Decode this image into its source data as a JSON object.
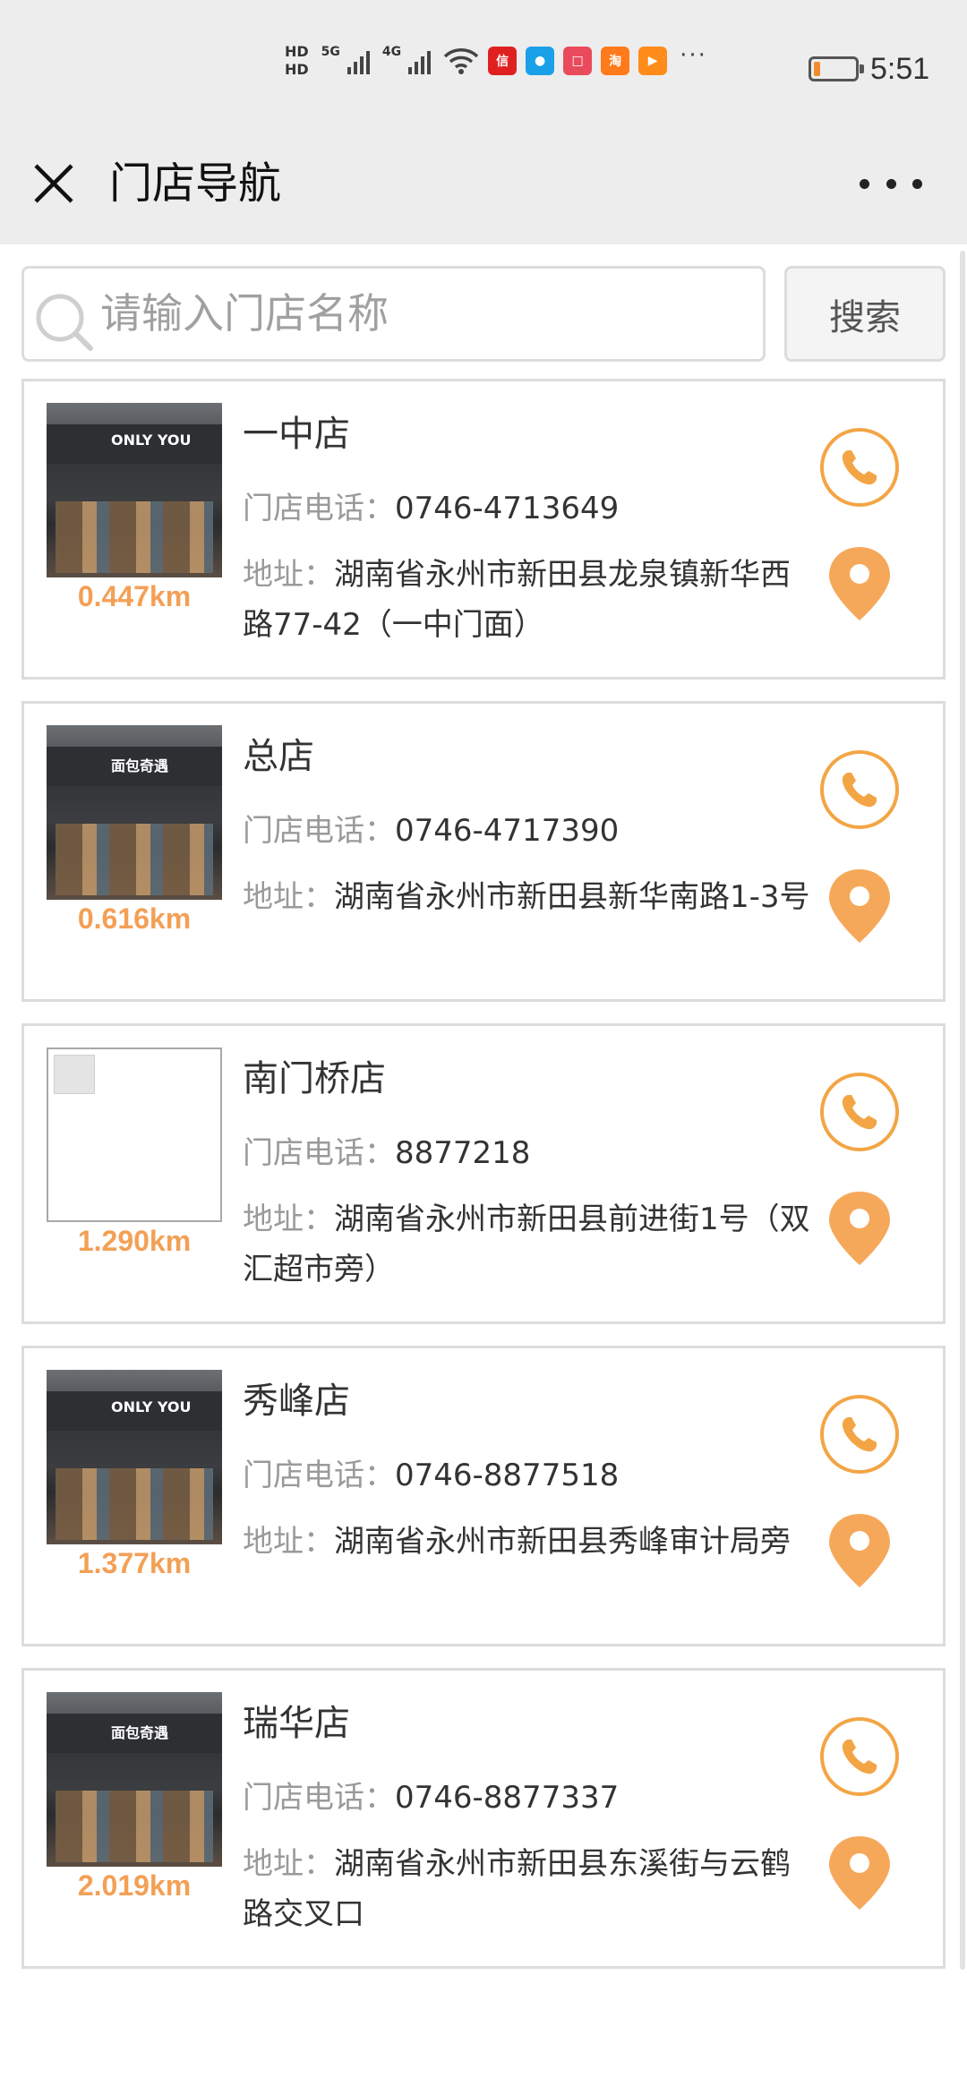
{
  "status_bar": {
    "hd1": "HD",
    "hd2": "HD",
    "net1": "5G",
    "net2": "4G",
    "apps": [
      {
        "name": "weibo-app-icon",
        "text": "信",
        "color": "#e02020"
      },
      {
        "name": "tmall-app-icon",
        "text": "●",
        "color": "#1aa0e8"
      },
      {
        "name": "reader-app-icon",
        "text": "□",
        "color": "#e94b5c"
      },
      {
        "name": "taobao-app-icon",
        "text": "淘",
        "color": "#ff7a1a"
      },
      {
        "name": "video-app-icon",
        "text": "▶",
        "color": "#ff8c1a"
      }
    ],
    "overflow": "···",
    "battery_level": 0.15,
    "time": "5:51"
  },
  "header": {
    "title": "门店导航"
  },
  "search": {
    "placeholder": "请输入门店名称",
    "button_label": "搜索"
  },
  "labels": {
    "phone": "门店电话：",
    "address": "地址："
  },
  "stores": [
    {
      "name": "一中店",
      "phone": "0746-4713649",
      "address": "湖南省永州市新田县龙泉镇新华西路77-42（一中门面）",
      "distance": "0.447km",
      "has_photo": true,
      "photo_sign": "ONLY YOU"
    },
    {
      "name": "总店",
      "phone": "0746-4717390",
      "address": "湖南省永州市新田县新华南路1-3号",
      "distance": "0.616km",
      "has_photo": true,
      "photo_sign": "面包奇遇"
    },
    {
      "name": "南门桥店",
      "phone": "8877218",
      "address": "湖南省永州市新田县前进街1号（双汇超市旁）",
      "distance": "1.290km",
      "has_photo": false,
      "photo_sign": ""
    },
    {
      "name": "秀峰店",
      "phone": "0746-8877518",
      "address": "湖南省永州市新田县秀峰审计局旁",
      "distance": "1.377km",
      "has_photo": true,
      "photo_sign": "ONLY YOU"
    },
    {
      "name": "瑞华店",
      "phone": "0746-8877337",
      "address": "湖南省永州市新田县东溪街与云鹤路交叉口",
      "distance": "2.019km",
      "has_photo": true,
      "photo_sign": "面包奇遇"
    }
  ],
  "colors": {
    "accent": "#f3a545",
    "distance": "#f3a056",
    "background_bar": "#ededed",
    "border": "#dcdcdc"
  }
}
